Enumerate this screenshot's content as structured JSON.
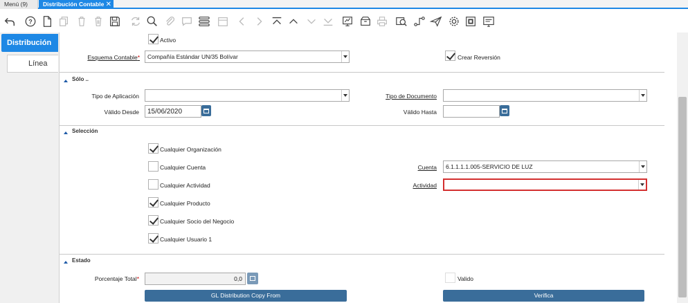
{
  "tabs": {
    "menu": "Menú (9)",
    "active": "Distribución Contable"
  },
  "side_tabs": [
    "Distribución",
    "Línea"
  ],
  "form": {
    "activo_label": "Activo",
    "esquema_label": "Esquema Contable",
    "esquema_value": "Compañía Estándar UN/35 Bolívar",
    "crear_reversion_label": "Crear Reversión",
    "solo_title": "Sólo ..",
    "tipo_aplicacion_label": "Tipo de Aplicación",
    "tipo_documento_label": "Tipo de Documento",
    "valido_desde_label": "Válido Desde",
    "valido_desde_value": "15/06/2020",
    "valido_hasta_label": "Válido Hasta",
    "seleccion_title": "Selección",
    "any_org_label": "Cualquier Organización",
    "any_cuenta_label": "Cualquier Cuenta",
    "any_actividad_label": "Cualquier Actividad",
    "any_producto_label": "Cualquier Producto",
    "any_socio_label": "Cualquier Socio del Negocio",
    "any_usuario_label": "Cualquier Usuario 1",
    "cuenta_label": "Cuenta",
    "cuenta_value": "6.1.1.1.1.005-SERVICIO DE LUZ",
    "actividad_label": "Actividad",
    "estado_title": "Estado",
    "porcentaje_label": "Porcentaje Total",
    "porcentaje_value": "0,0",
    "valido_label": "Valido",
    "copy_button": "GL Distribution Copy From",
    "verifica_button": "Verifica",
    "required_mark": "*"
  },
  "colors": {
    "accent": "#1e88e5",
    "button": "#3a6d9a",
    "error_border": "#d32f2f"
  }
}
